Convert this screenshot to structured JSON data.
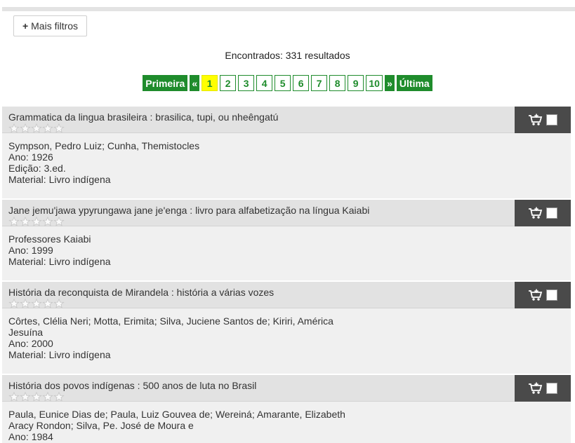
{
  "filters": {
    "label": "Mais filtros"
  },
  "results_text": "Encontrados: 331 resultados",
  "pagination": {
    "first": "Primeira",
    "prev": "«",
    "pages": [
      "1",
      "2",
      "3",
      "4",
      "5",
      "6",
      "7",
      "8",
      "9",
      "10"
    ],
    "current": "1",
    "next": "»",
    "last": "Última"
  },
  "colors": {
    "accent": "#1f8c2c",
    "current_page": "#ffff00",
    "cart_bg": "#4a4a4a"
  },
  "items": [
    {
      "title": "Grammatica da lingua brasileira : brasilica, tupi, ou nheêngatú",
      "lines": [
        "Sympson, Pedro Luiz; Cunha, Themistocles",
        "Ano: 1926",
        "Edição: 3.ed.",
        "Material: Livro indígena"
      ]
    },
    {
      "title": "Jane jemu'jawa ypyrungawa jane je'enga : livro para alfabetização na língua Kaiabi",
      "lines": [
        "Professores Kaiabi",
        "Ano: 1999",
        "Material: Livro indígena"
      ]
    },
    {
      "title": "História da reconquista de Mirandela : história a várias vozes",
      "lines": [
        "Côrtes, Clélia Neri; Motta, Erimita; Silva, Juciene Santos de; Kiriri, América",
        "Jesuína",
        "Ano: 2000",
        "Material: Livro indígena"
      ]
    },
    {
      "title": "História dos povos indígenas : 500 anos de luta no Brasil",
      "lines": [
        "Paula, Eunice Dias de; Paula, Luiz Gouvea de; Wereiná; Amarante, Elizabeth",
        "Aracy Rondon; Silva, Pe. José de Moura e",
        "Ano: 1984"
      ]
    }
  ]
}
